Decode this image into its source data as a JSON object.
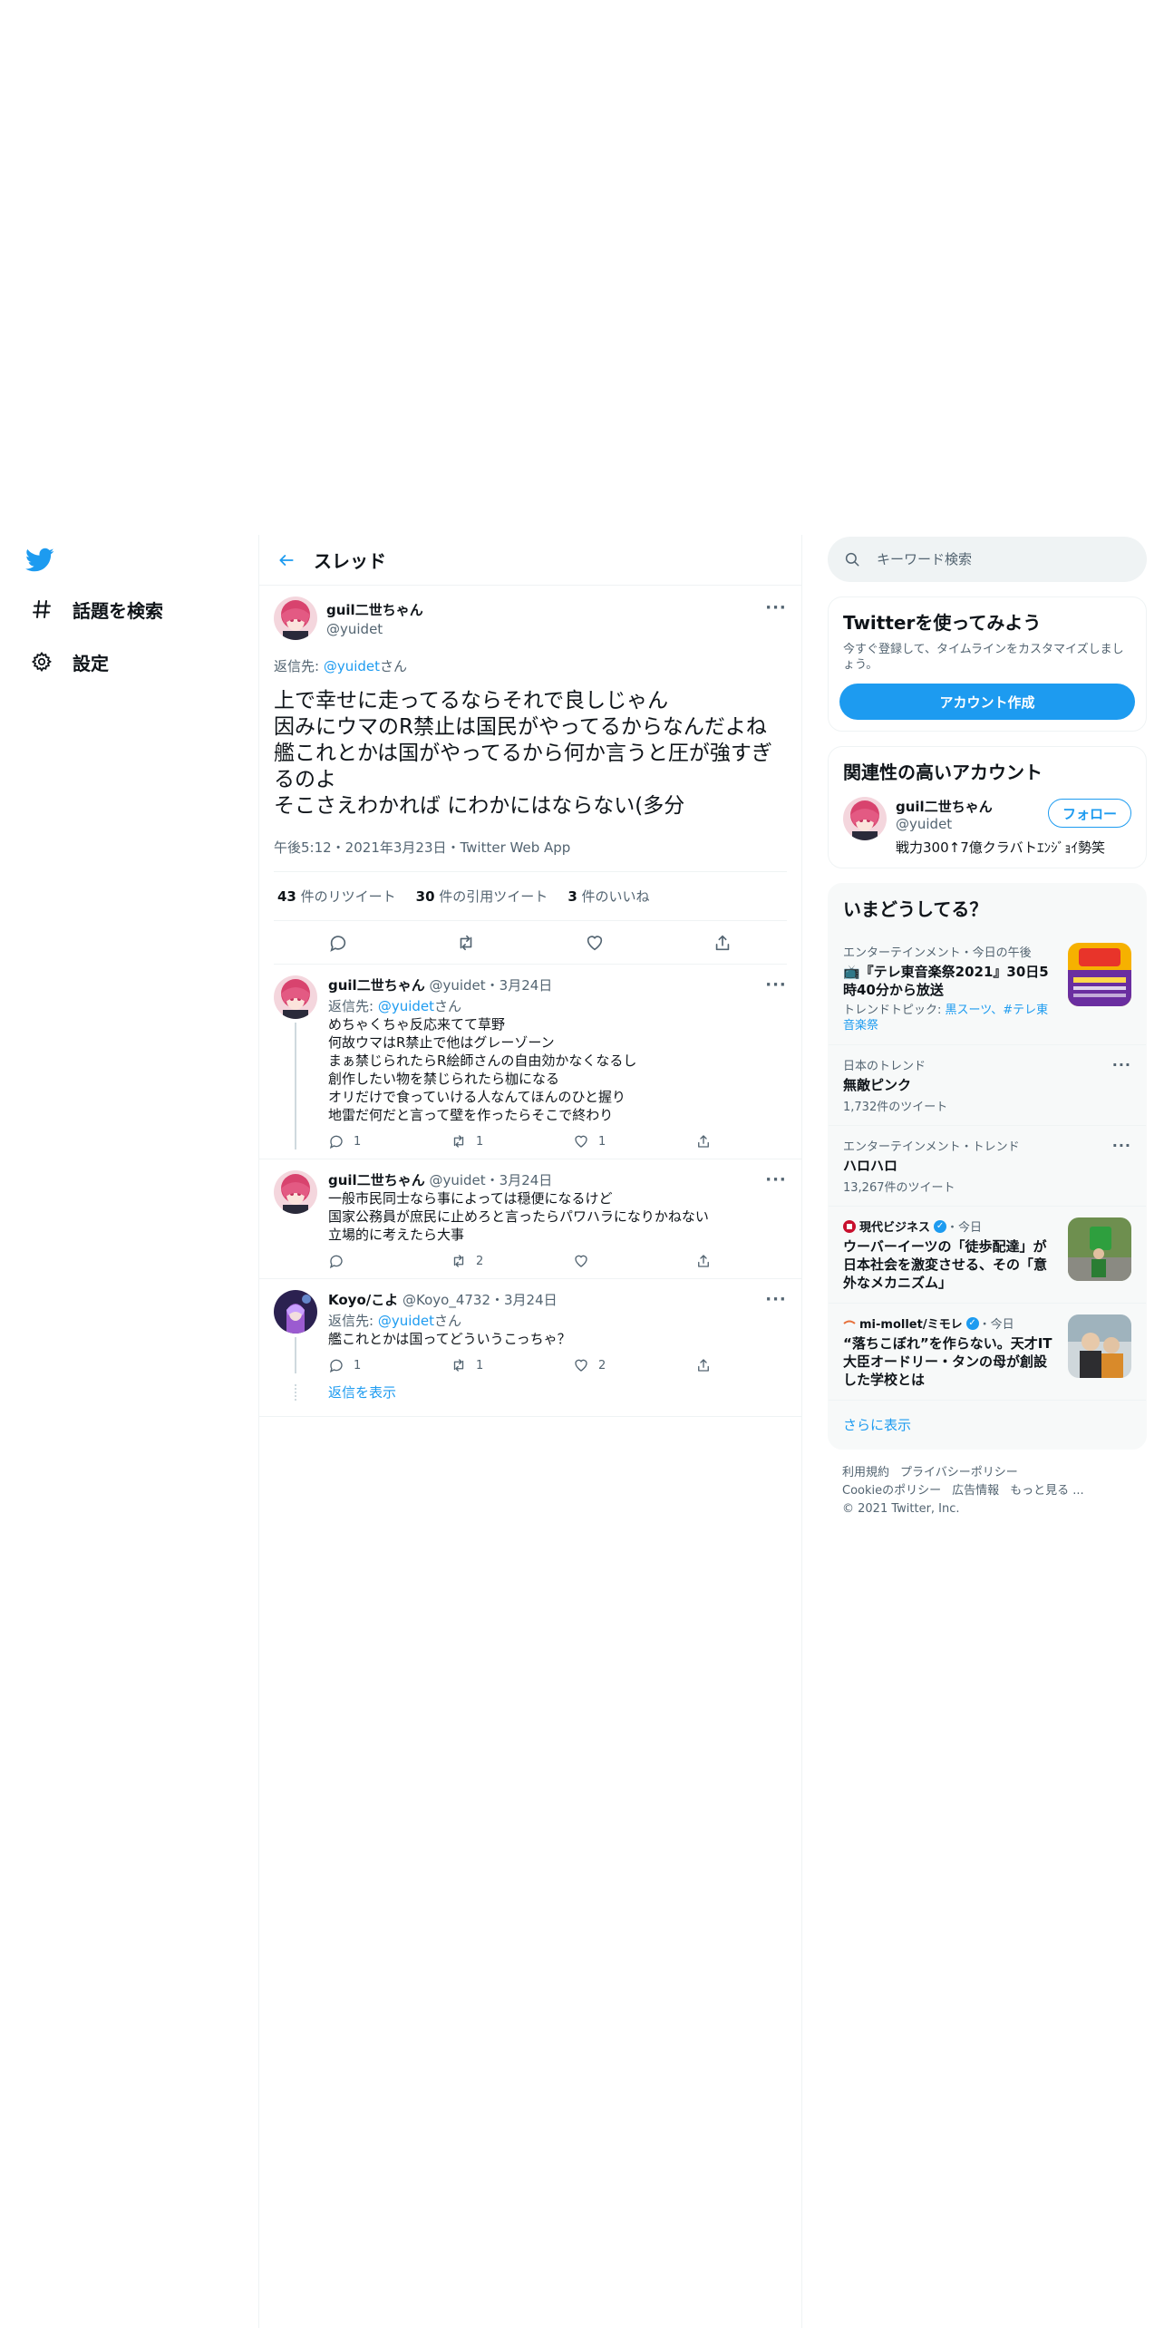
{
  "nav": {
    "items": [
      {
        "label": "話題を検索",
        "icon": "hash-icon"
      },
      {
        "label": "設定",
        "icon": "gear-icon"
      }
    ]
  },
  "thread": {
    "title": "スレッド",
    "focal": {
      "name": "guil二世ちゃん",
      "handle": "@yuidet",
      "reply_prefix": "返信先: ",
      "reply_handle": "@yuidet",
      "reply_suffix": "さん",
      "text": "上で幸せに走ってるならそれで良しじゃん\n因みにウマのR禁止は国民がやってるからなんだよね\n艦これとかは国がやってるから何か言うと圧が強すぎるのよ\nそこさえわかれば にわかにはならない(多分",
      "meta": "午後5:12・2021年3月23日・Twitter Web App",
      "retweets": "43",
      "retweets_label": " 件のリツイート",
      "quotes": "30",
      "quotes_label": " 件の引用ツイート",
      "likes": "3",
      "likes_label": " 件のいいね"
    },
    "replies": [
      {
        "name": "guil二世ちゃん",
        "handle": "@yuidet",
        "date": "・3月24日",
        "reply_prefix": "返信先: ",
        "reply_handle": "@yuidet",
        "reply_suffix": "さん",
        "text": "めちゃくちゃ反応来てて草野\n何故ウマはR禁止で他はグレーゾーン\nまぁ禁じられたらR絵師さんの自由効かなくなるし\n創作したい物を禁じられたら枷になる\nオリだけで食っていける人なんてほんのひと握り\n地雷だ何だと言って壁を作ったらそこで終わり",
        "replies": "1",
        "retweets": "1",
        "likes": "1"
      },
      {
        "name": "guil二世ちゃん",
        "handle": "@yuidet",
        "date": "・3月24日",
        "text": "一般市民同士なら事によっては穏便になるけど\n国家公務員が庶民に止めろと言ったらパワハラになりかねない\n立場的に考えたら大事",
        "replies": "",
        "retweets": "2",
        "likes": ""
      },
      {
        "name": "Koyo/こよ",
        "handle": "@Koyo_4732",
        "date": "・3月24日",
        "reply_prefix": "返信先: ",
        "reply_handle": "@yuidet",
        "reply_suffix": "さん",
        "text": "艦これとかは国ってどういうこっちゃ？",
        "replies": "1",
        "retweets": "1",
        "likes": "2"
      }
    ],
    "show_replies": "返信を表示"
  },
  "search": {
    "placeholder": "キーワード検索"
  },
  "signup": {
    "title": "Twitterを使ってみよう",
    "sub": "今すぐ登録して、タイムラインをカスタマイズしましょう。",
    "button": "アカウント作成"
  },
  "related": {
    "title": "関連性の高いアカウント",
    "name": "guil二世ちゃん",
    "handle": "@yuidet",
    "bio": "戦力300↑7億クラバトｴﾝｼﾞｮｲ勢笑",
    "follow": "フォロー"
  },
  "trends": {
    "title": "いまどうしてる？",
    "items": [
      {
        "category": "エンターテインメント・今日の午後",
        "title": "📺『テレ東音楽祭2021』30日5時40分から放送",
        "topic_prefix": "トレンドトピック: ",
        "topics": "黒スーツ、#テレ東音楽祭"
      },
      {
        "category": "日本のトレンド",
        "title": "無敵ピンク",
        "count": "1,732件のツイート"
      },
      {
        "category": "エンターテインメント・トレンド",
        "title": "ハロハロ",
        "count": "13,267件のツイート"
      },
      {
        "source": "現代ビジネス",
        "time": "・今日",
        "title": "ウーバーイーツの「徒歩配達」が日本社会を激変させる、その「意外なメカニズム」"
      },
      {
        "source": "mi-mollet/ミモレ",
        "time": "・今日",
        "title": "“落ちこぼれ”を作らない。天才IT大臣オードリー・タンの母が創設した学校とは"
      }
    ],
    "show_more": "さらに表示"
  },
  "footer": {
    "links": [
      "利用規約",
      "プライバシーポリシー",
      "Cookieのポリシー",
      "広告情報",
      "もっと見る ..."
    ],
    "copyright": "© 2021 Twitter, Inc."
  },
  "colors": {
    "accent": "#1d9bf0",
    "text": "#0f1419",
    "secondary": "#536471",
    "border": "#eff3f4"
  }
}
